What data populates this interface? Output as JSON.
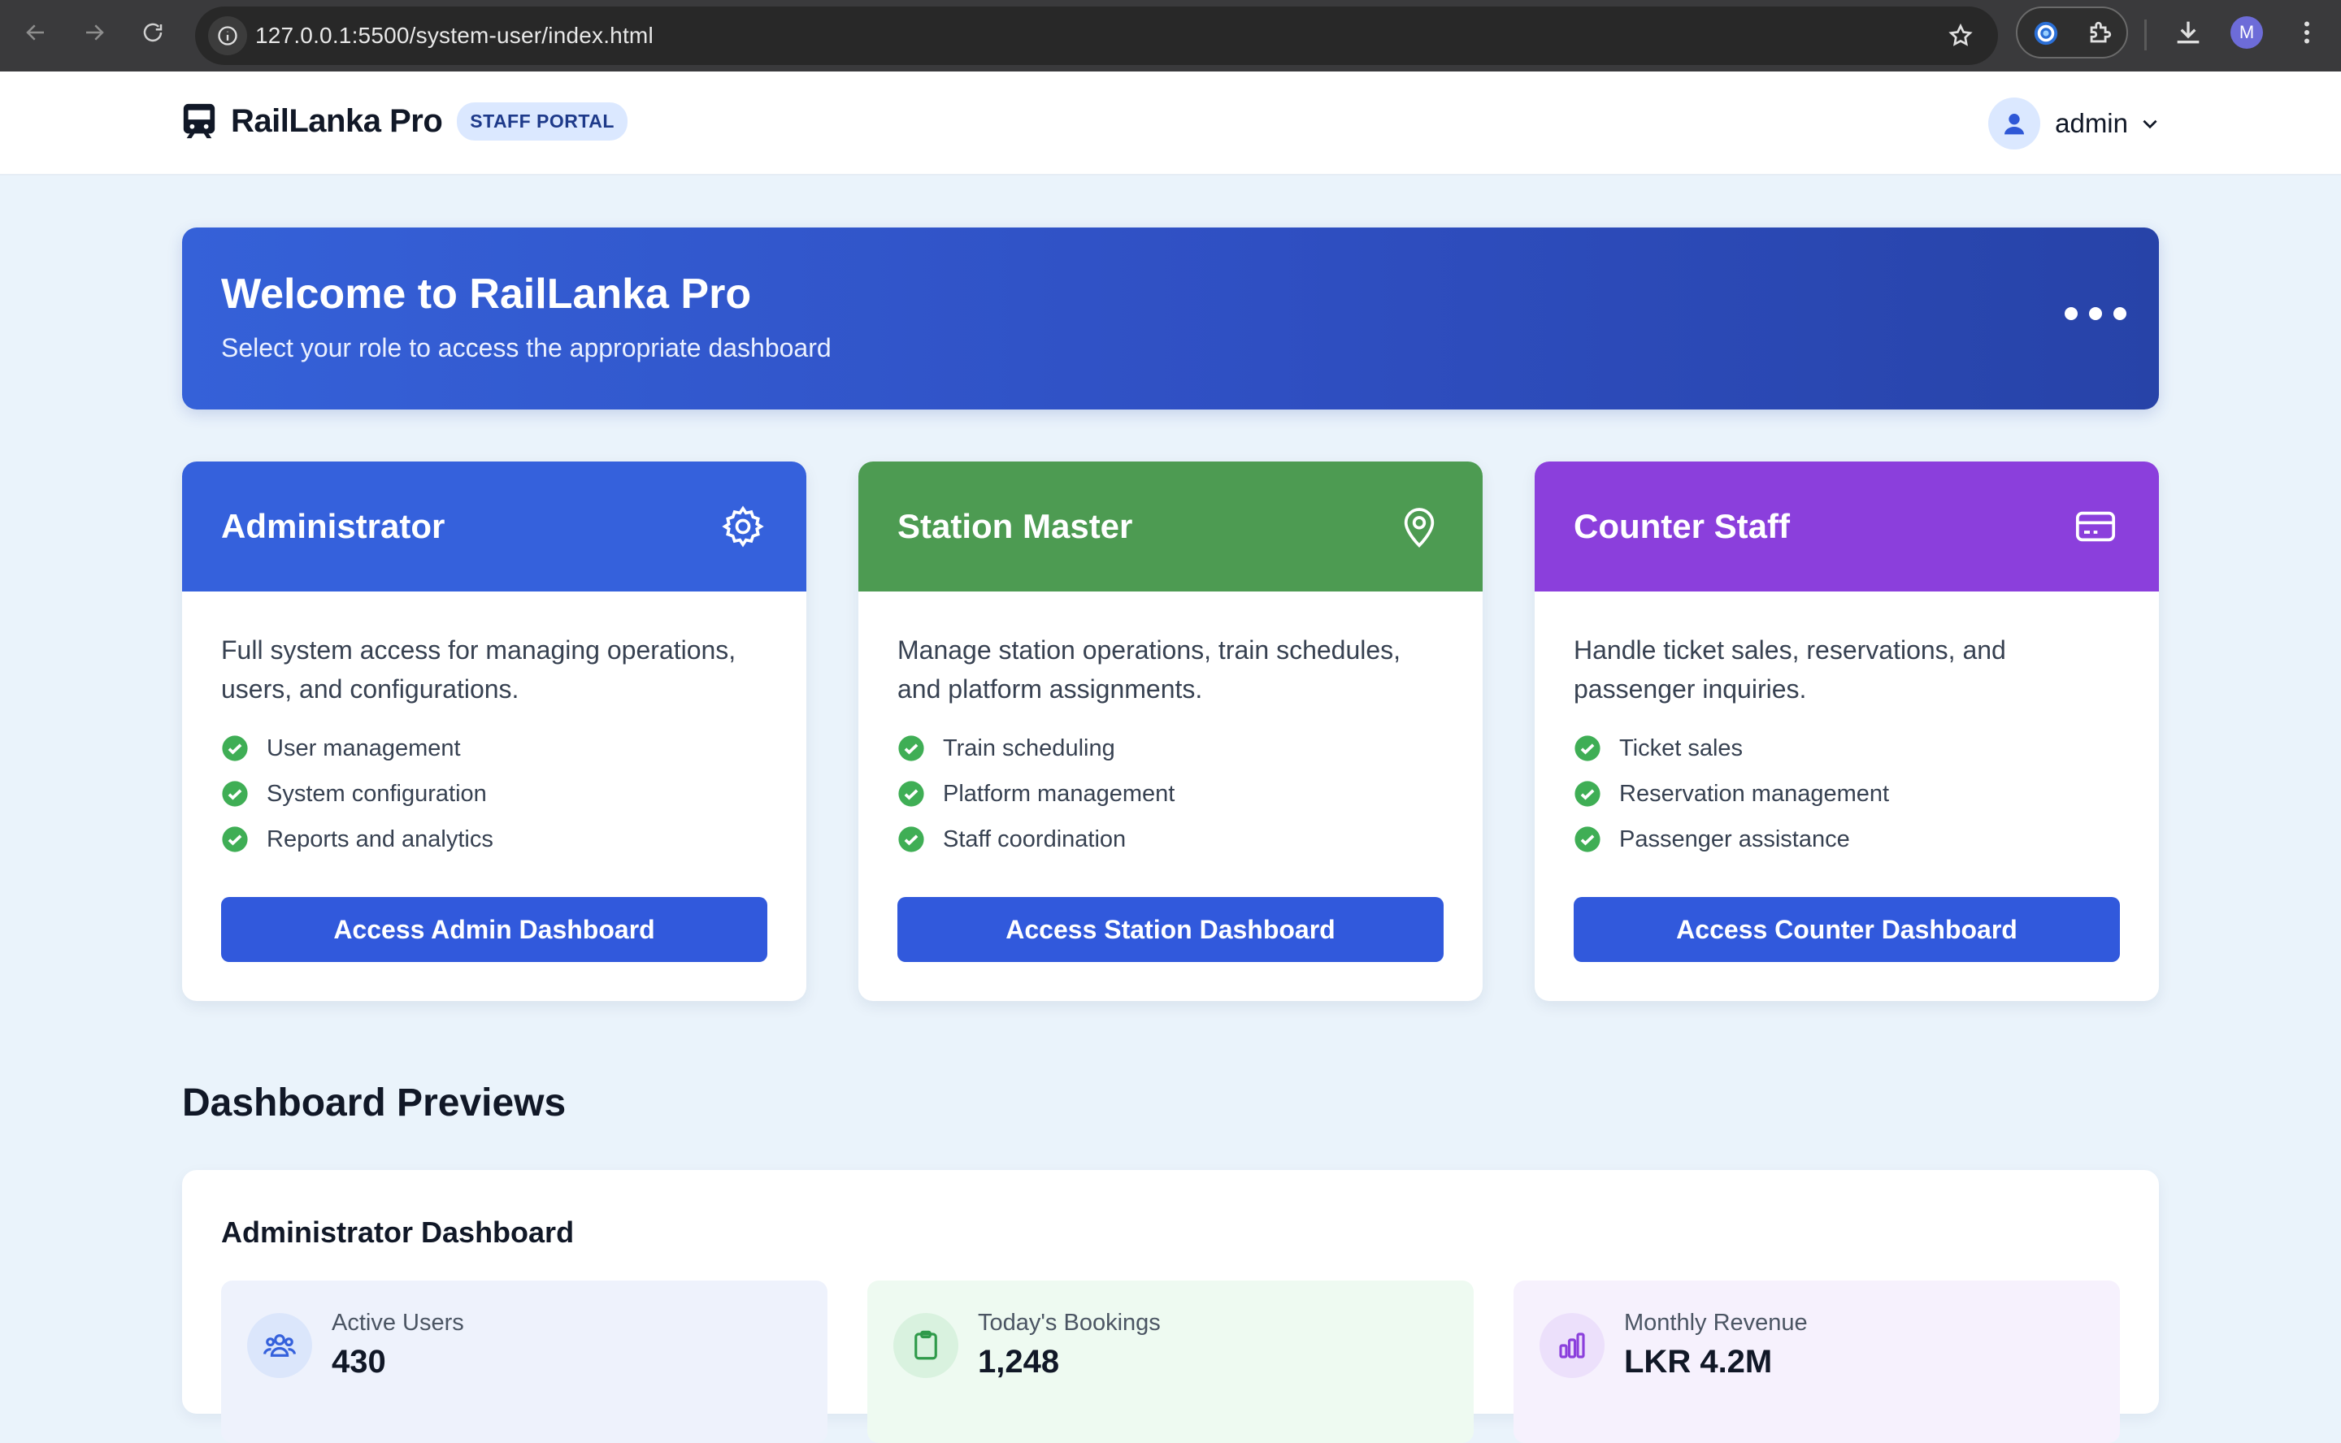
{
  "browser": {
    "url": "127.0.0.1:5500/system-user/index.html",
    "profile_initial": "M"
  },
  "header": {
    "brand_name": "RailLanka Pro",
    "badge": "STAFF PORTAL",
    "username": "admin"
  },
  "welcome": {
    "title": "Welcome to RailLanka Pro",
    "subtitle": "Select your role to access the appropriate dashboard"
  },
  "roles": [
    {
      "title": "Administrator",
      "icon": "gear-icon",
      "color": "#3561dc",
      "description": "Full system access for managing operations, users, and configurations.",
      "features": [
        "User management",
        "System configuration",
        "Reports and analytics"
      ],
      "button": "Access Admin Dashboard"
    },
    {
      "title": "Station Master",
      "icon": "location-pin-icon",
      "color": "#4d9b52",
      "description": "Manage station operations, train schedules, and platform assignments.",
      "features": [
        "Train scheduling",
        "Platform management",
        "Staff coordination"
      ],
      "button": "Access Station Dashboard"
    },
    {
      "title": "Counter Staff",
      "icon": "credit-card-icon",
      "color": "#8b3fdc",
      "description": "Handle ticket sales, reservations, and passenger inquiries.",
      "features": [
        "Ticket sales",
        "Reservation management",
        "Passenger assistance"
      ],
      "button": "Access Counter Dashboard"
    }
  ],
  "previews": {
    "section_title": "Dashboard Previews",
    "panel_title": "Administrator Dashboard",
    "stats": [
      {
        "label": "Active Users",
        "value": "430",
        "icon": "users-icon",
        "bg": "#eef2fc",
        "icon_bg": "#dbe6fb",
        "icon_color": "#3561dc"
      },
      {
        "label": "Today's Bookings",
        "value": "1,248",
        "icon": "clipboard-icon",
        "bg": "#eefaf1",
        "icon_bg": "#d9f2df",
        "icon_color": "#2f9a4a"
      },
      {
        "label": "Monthly Revenue",
        "value": "LKR 4.2M",
        "icon": "bar-chart-icon",
        "bg": "#f6f1fd",
        "icon_bg": "#ece0fb",
        "icon_color": "#8b3fdc"
      }
    ]
  }
}
